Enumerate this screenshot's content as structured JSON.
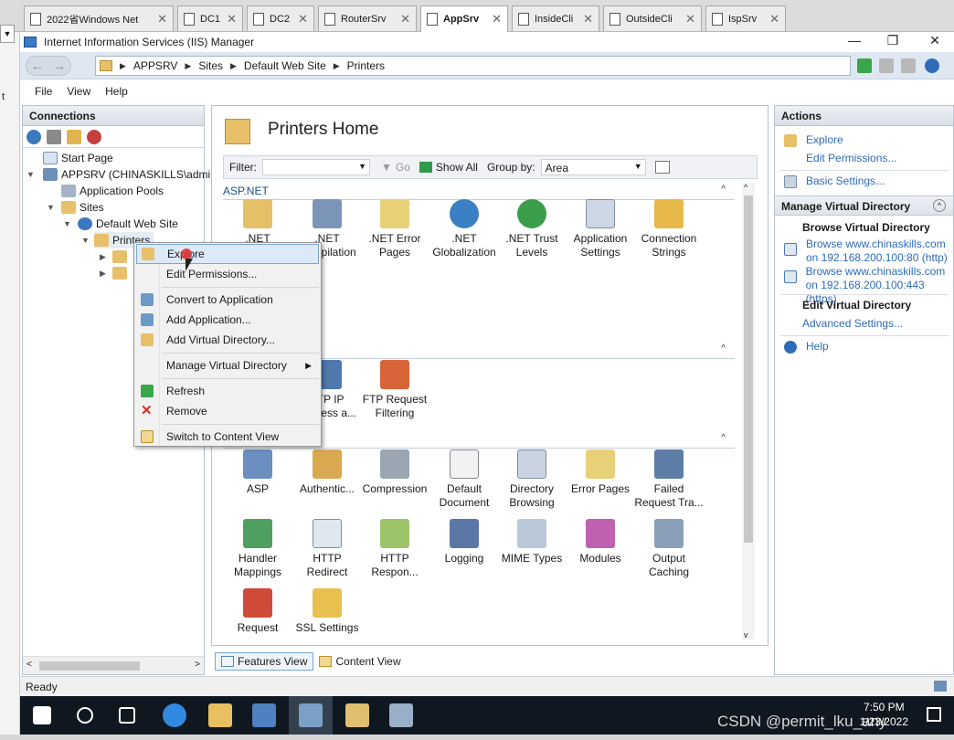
{
  "vm_tabs": [
    {
      "label": "2022省Windows Net",
      "active": false
    },
    {
      "label": "DC1",
      "active": false
    },
    {
      "label": "DC2",
      "active": false
    },
    {
      "label": "RouterSrv",
      "active": false
    },
    {
      "label": "AppSrv",
      "active": true
    },
    {
      "label": "InsideCli",
      "active": false
    },
    {
      "label": "OutsideCli",
      "active": false
    },
    {
      "label": "IspSrv",
      "active": false
    }
  ],
  "host_strip": {
    "text": "t"
  },
  "window": {
    "title": "Internet Information Services (IIS) Manager",
    "minimize": "—",
    "restore": "❐",
    "close": "✕"
  },
  "address": {
    "segments": [
      "APPSRV",
      "Sites",
      "Default Web Site",
      "Printers"
    ]
  },
  "menu": [
    "File",
    "View",
    "Help"
  ],
  "connections": {
    "header": "Connections",
    "tree": {
      "start_page": "Start Page",
      "server": "APPSRV (CHINASKILLS\\admin",
      "app_pools": "Application Pools",
      "sites": "Sites",
      "default_site": "Default Web Site",
      "printers": "Printers"
    }
  },
  "center": {
    "title": "Printers Home",
    "filter": {
      "label": "Filter:",
      "go": "Go",
      "show_all": "Show All",
      "group_by": "Group by:",
      "group_value": "Area"
    },
    "groups": {
      "aspnet": "ASP.NET"
    },
    "features_aspnet": [
      ".NET Authorizat...",
      ".NET Compilation",
      ".NET Error Pages",
      ".NET Globalization",
      ".NET Trust Levels",
      "Application Settings",
      "Connection Strings"
    ],
    "features_ftp": [
      "FTP IP Address a...",
      "FTP Request Filtering"
    ],
    "features_iis": [
      "ASP",
      "Authentic...",
      "Compression",
      "Default Document",
      "Directory Browsing",
      "Error Pages",
      "Failed Request Tra...",
      "Handler Mappings",
      "HTTP Redirect",
      "HTTP Respon...",
      "Logging",
      "MIME Types",
      "Modules",
      "Output Caching",
      "Request Filtering",
      "SSL Settings"
    ],
    "view_tabs": {
      "features": "Features View",
      "content": "Content View"
    }
  },
  "actions": {
    "header": "Actions",
    "explore": "Explore",
    "edit_permissions": "Edit Permissions...",
    "basic_settings": "Basic Settings...",
    "manage_vdir": "Manage Virtual Directory",
    "browse_vdir": "Browse Virtual Directory",
    "browse_http_1": "Browse www.chinaskills.com",
    "browse_http_2": "on 192.168.200.100:80 (http)",
    "browse_https_1": "Browse www.chinaskills.com",
    "browse_https_2": "on 192.168.200.100:443 (https)",
    "edit_vdir": "Edit Virtual Directory",
    "advanced_settings": "Advanced Settings...",
    "help": "Help"
  },
  "context_menu": [
    {
      "label": "Explore",
      "icon": "explore-icon",
      "highlight": true
    },
    {
      "label": "Edit Permissions...",
      "icon": ""
    },
    {
      "label": "Convert to Application",
      "icon": "convert-app-icon"
    },
    {
      "label": "Add Application...",
      "icon": "add-app-icon"
    },
    {
      "label": "Add Virtual Directory...",
      "icon": "add-vdir-icon"
    },
    {
      "label": "Manage Virtual Directory",
      "icon": "",
      "submenu": true
    },
    {
      "label": "Refresh",
      "icon": "refresh-icon"
    },
    {
      "label": "Remove",
      "icon": "remove-icon"
    },
    {
      "label": "Switch to Content View",
      "icon": "content-view-icon"
    }
  ],
  "status": {
    "text": "Ready"
  },
  "taskbar": {
    "time": "7:50 PM",
    "date": "1/23/2022",
    "watermark": "CSDN @permit_lku_any"
  },
  "colors": {
    "accent": "#2f6bb8",
    "menu_highlight": "#dbe9f8",
    "group_header": "#1d4e86",
    "taskbar": "#0f1720"
  }
}
